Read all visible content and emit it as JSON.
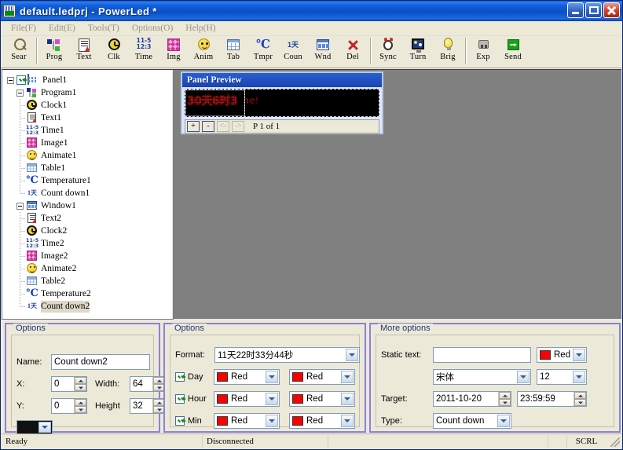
{
  "window": {
    "title": "default.ledprj - PowerLed *",
    "icon": "app-led-icon",
    "buttons": {
      "minimize": "minimize",
      "maximize": "maximize",
      "close": "close"
    }
  },
  "menubar": {
    "items": [
      {
        "label": "File(F)"
      },
      {
        "label": "Edit(E)"
      },
      {
        "label": "Tools(T)"
      },
      {
        "label": "Options(O)"
      },
      {
        "label": "Help(H)"
      }
    ]
  },
  "toolbar": {
    "items": [
      {
        "label": "Sear",
        "icon": "magnifier-icon",
        "cls": "i-sear"
      },
      {
        "sep": true
      },
      {
        "label": "Prog",
        "icon": "program-icon",
        "cls": "i-prog"
      },
      {
        "label": "Text",
        "icon": "text-icon",
        "cls": "i-text"
      },
      {
        "label": "Clk",
        "icon": "clock-icon",
        "cls": "i-clk"
      },
      {
        "label": "Time",
        "icon": "date-time-icon",
        "cls": "i-time",
        "glyph": "11-5\n12:3"
      },
      {
        "label": "Img",
        "icon": "image-icon",
        "cls": "i-img"
      },
      {
        "label": "Anim",
        "icon": "animation-smiley-icon",
        "cls": "i-anim"
      },
      {
        "label": "Tab",
        "icon": "table-icon",
        "cls": "i-tab"
      },
      {
        "label": "Tmpr",
        "icon": "temperature-icon",
        "cls": "i-tmpr",
        "glyph": "℃"
      },
      {
        "label": "Coun",
        "icon": "count-down-icon",
        "cls": "i-coun",
        "glyph": "1天"
      },
      {
        "label": "Wnd",
        "icon": "window-icon",
        "cls": "i-wnd"
      },
      {
        "label": "Del",
        "icon": "delete-x-icon",
        "cls": "i-del"
      },
      {
        "sep": true
      },
      {
        "label": "Sync",
        "icon": "sync-clock-icon",
        "cls": "i-sync"
      },
      {
        "label": "Turn",
        "icon": "turn-on-off-screen-icon",
        "cls": "i-turn"
      },
      {
        "label": "Brig",
        "icon": "brightness-bulb-icon",
        "cls": "i-brig"
      },
      {
        "sep": true
      },
      {
        "label": "Exp",
        "icon": "export-usb-icon",
        "cls": "i-exp"
      },
      {
        "label": "Send",
        "icon": "send-arrow-icon",
        "cls": "i-send"
      }
    ]
  },
  "tree": {
    "nodes": [
      {
        "label": "Panel1",
        "indent": 0,
        "expander": "minus",
        "checkbox": true,
        "icon": "panel-icon"
      },
      {
        "label": "Program1",
        "indent": 1,
        "expander": "minus",
        "icon": "program-icon"
      },
      {
        "label": "Clock1",
        "indent": 2,
        "icon": "clock-icon"
      },
      {
        "label": "Text1",
        "indent": 2,
        "icon": "text-icon"
      },
      {
        "label": "Time1",
        "indent": 2,
        "icon": "date-time-icon"
      },
      {
        "label": "Image1",
        "indent": 2,
        "icon": "image-icon"
      },
      {
        "label": "Animate1",
        "indent": 2,
        "icon": "animation-smiley-icon"
      },
      {
        "label": "Table1",
        "indent": 2,
        "icon": "table-icon"
      },
      {
        "label": "Temperature1",
        "indent": 2,
        "icon": "temperature-icon"
      },
      {
        "label": "Count down1",
        "indent": 2,
        "icon": "count-down-icon",
        "last": true
      },
      {
        "label": "Window1",
        "indent": 1,
        "expander": "minus",
        "icon": "window-icon"
      },
      {
        "label": "Text2",
        "indent": 2,
        "icon": "text-icon"
      },
      {
        "label": "Clock2",
        "indent": 2,
        "icon": "clock-icon"
      },
      {
        "label": "Time2",
        "indent": 2,
        "icon": "date-time-icon"
      },
      {
        "label": "Image2",
        "indent": 2,
        "icon": "image-icon"
      },
      {
        "label": "Animate2",
        "indent": 2,
        "icon": "animation-smiley-icon"
      },
      {
        "label": "Table2",
        "indent": 2,
        "icon": "table-icon"
      },
      {
        "label": "Temperature2",
        "indent": 2,
        "icon": "temperature-icon"
      },
      {
        "label": "Count down2",
        "indent": 2,
        "icon": "count-down-icon",
        "selected": true,
        "last": true
      }
    ]
  },
  "preview": {
    "title": "Panel Preview",
    "led_text": "30天6时3",
    "led_text_background": "ome!",
    "led_color": "#e81414",
    "controls": {
      "zoom_in": "+",
      "zoom_out": "-",
      "prev": "<-",
      "next": "->",
      "page_info": "P 1 of 1"
    }
  },
  "options_left": {
    "legend": "Options",
    "name_label": "Name:",
    "name_value": "Count down2",
    "x_label": "X:",
    "x_value": "0",
    "width_label": "Width:",
    "width_value": "64",
    "y_label": "Y:",
    "y_value": "0",
    "height_label": "Height",
    "height_value": "32"
  },
  "options_middle": {
    "legend": "Options",
    "format_label": "Format:",
    "format_value": "11天22时33分44秒",
    "rows": [
      {
        "label": "Day",
        "checked": true,
        "color1": "Red",
        "color2": "Red",
        "swatch": "#ff0000"
      },
      {
        "label": "Hour",
        "checked": true,
        "color1": "Red",
        "color2": "Red",
        "swatch": "#ff0000"
      },
      {
        "label": "Min",
        "checked": true,
        "color1": "Red",
        "color2": "Red",
        "swatch": "#ff0000"
      }
    ]
  },
  "options_right": {
    "legend": "More options",
    "static_text_label": "Static text:",
    "static_text_value": "",
    "static_color": "Red",
    "static_swatch": "#ff0000",
    "font_value": "宋体",
    "font_size_value": "12",
    "target_label": "Target:",
    "target_date": "2011-10-20",
    "target_time": "23:59:59",
    "type_label": "Type:",
    "type_value": "Count down"
  },
  "statusbar": {
    "ready": "Ready",
    "connection": "Disconnected",
    "blank": "",
    "scroll_lock": "SCRL"
  }
}
